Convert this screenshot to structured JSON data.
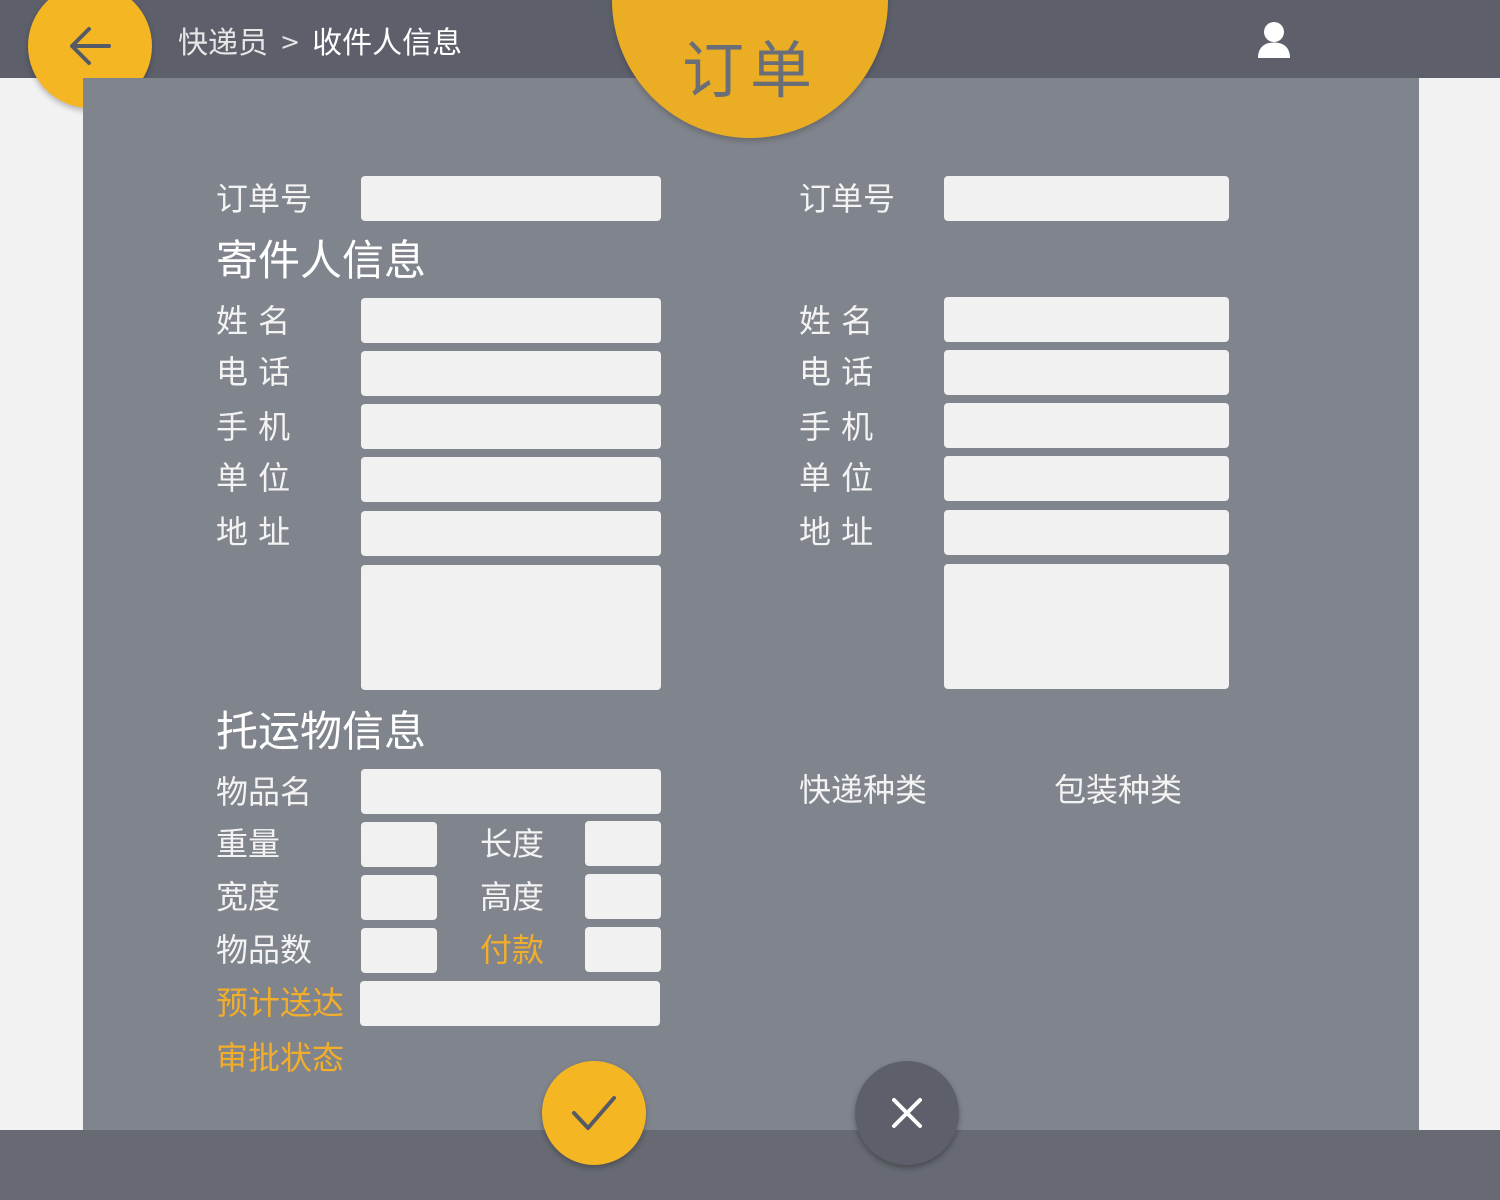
{
  "header": {
    "breadcrumb_parent": "快递员",
    "breadcrumb_separator": ">",
    "breadcrumb_current": "收件人信息",
    "title": "订单"
  },
  "left": {
    "order_label": "订单号",
    "order_value": "",
    "section_title": "寄件人信息",
    "name_label": "姓 名",
    "name_value": "",
    "phone_label": "电 话",
    "phone_value": "",
    "mobile_label": "手 机",
    "mobile_value": "",
    "company_label": "单 位",
    "company_value": "",
    "address_label": "地 址",
    "address_value": "",
    "address_detail_value": ""
  },
  "right": {
    "order_label": "订单号",
    "order_value": "",
    "name_label": "姓 名",
    "name_value": "",
    "phone_label": "电 话",
    "phone_value": "",
    "mobile_label": "手 机",
    "mobile_value": "",
    "company_label": "单 位",
    "company_value": "",
    "address_label": "地 址",
    "address_value": "",
    "address_detail_value": ""
  },
  "cargo": {
    "section_title": "托运物信息",
    "item_name_label": "物品名",
    "item_name_value": "",
    "weight_label": "重量",
    "weight_value": "",
    "length_label": "长度",
    "length_value": "",
    "width_label": "宽度",
    "width_value": "",
    "height_label": "高度",
    "height_value": "",
    "count_label": "物品数",
    "count_value": "",
    "payment_label": "付款",
    "payment_value": "",
    "eta_label": "预计送达",
    "eta_value": "",
    "approval_label": "审批状态",
    "express_type_label": "快递种类",
    "package_type_label": "包装种类"
  },
  "icons": {
    "back": "arrow-left-icon",
    "user": "user-icon",
    "confirm": "check-icon",
    "cancel": "close-icon"
  },
  "colors": {
    "accent": "#f5b623",
    "header_bg": "#5d606b",
    "panel_bg": "#80848c",
    "highlight_label": "#f2ad2b"
  }
}
